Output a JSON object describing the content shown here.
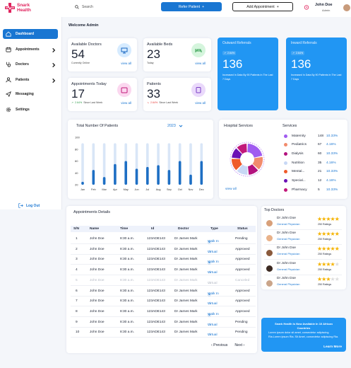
{
  "brand": {
    "name_line1": "Snark",
    "name_line2": "Health"
  },
  "topbar": {
    "search_placeholder": "Search",
    "refer_label": "Refer Patient",
    "appointment_label": "Add Appointment"
  },
  "user": {
    "name": "John Doe",
    "role": "Admin"
  },
  "sidebar": {
    "items": [
      {
        "label": "Dashboard"
      },
      {
        "label": "Appointments"
      },
      {
        "label": "Doctors"
      },
      {
        "label": "Patients"
      },
      {
        "label": "Messaging"
      },
      {
        "label": "Settings"
      }
    ],
    "logout": "Log Out"
  },
  "welcome": "Welcome Admin",
  "stats": [
    {
      "title": "Available Doctors",
      "value": "54",
      "sub": "Currently Online",
      "link": "view all"
    },
    {
      "title": "Available Beds",
      "value": "23",
      "sub": "Today",
      "link": "view all"
    },
    {
      "title": "Appointments Today",
      "value": "17",
      "sub": "Since Last Week",
      "delta": "2.64%",
      "link": "view all"
    },
    {
      "title": "Patients",
      "value": "33",
      "sub": "Since Last Week",
      "delta": "2.64%",
      "link": "view all"
    }
  ],
  "referrals": [
    {
      "title": "Outward Referrals",
      "badge": "2.64%",
      "value": "136",
      "sub": "Increased In Data  By 90 Patients In The Last 7 Days"
    },
    {
      "title": "Inward Referrals",
      "badge": "2.64%",
      "value": "136",
      "sub": "Increased In Data  By 90 Patients In The Last 7 Days"
    }
  ],
  "patients_chart": {
    "title": "Total Number Of Patients",
    "year": "2023"
  },
  "chart_data": {
    "type": "bar",
    "title": "Total Number Of Patients",
    "categories": [
      "Jan",
      "Feb",
      "Mar",
      "Apr",
      "May",
      "Jun",
      "Jul",
      "Aug",
      "Sep",
      "Oct",
      "Nov",
      "Dec"
    ],
    "series": [
      {
        "values": [
          25,
          45,
          33,
          55,
          60,
          47,
          50,
          53,
          45,
          60,
          37,
          60
        ]
      },
      {
        "values": [
          90,
          90,
          90,
          90,
          90,
          90,
          90,
          90,
          90,
          90,
          90,
          90
        ]
      }
    ],
    "yticks": [
      20,
      40,
      60,
      80,
      100
    ],
    "ylim": [
      20,
      100
    ],
    "colors": {
      "foreground": "#1e6fc4",
      "background": "#d9e6f7"
    }
  },
  "hospital_services": {
    "title": "Hospital Services",
    "services_label": "Services",
    "link": "view all",
    "items": [
      {
        "name": "Maternity",
        "count": "148",
        "pct": "10.33%",
        "color": "#a05bf0"
      },
      {
        "name": "Pediatrics",
        "count": "67",
        "pct": "4.16%",
        "color": "#f28b6c"
      },
      {
        "name": "Dialysis",
        "count": "60",
        "pct": "10.33%",
        "color": "#b3127e"
      },
      {
        "name": "Nutrition",
        "count": "35",
        "pct": "4.16%",
        "color": "#c8d8f5"
      },
      {
        "name": "Mental...",
        "count": "21",
        "pct": "10.33%",
        "color": "#ef5a29"
      },
      {
        "name": "Special...",
        "count": "12",
        "pct": "4.16%",
        "color": "#6a10b5"
      },
      {
        "name": "Pharmacy",
        "count": "5",
        "pct": "10.33%",
        "color": "#c2187a"
      }
    ]
  },
  "appointments": {
    "title": "Appointments Details",
    "headers": [
      "S/N",
      "Name",
      "Time",
      "Id",
      "Doctor",
      "Type",
      "Status"
    ],
    "rows": [
      {
        "sn": "1",
        "name": "John Doe",
        "time": "8:30 a.m.",
        "id": "123ADE143",
        "doctor": "Dr James Mark",
        "type": "Walk In",
        "status": "Pending",
        "dim": false
      },
      {
        "sn": "2",
        "name": "John Doe",
        "time": "8:30 a.m.",
        "id": "123ADE143",
        "doctor": "Dr James Mark",
        "type": "Virtual",
        "status": "Approved",
        "dim": false
      },
      {
        "sn": "3",
        "name": "John Doe",
        "time": "8:30 a.m.",
        "id": "123ADE143",
        "doctor": "Dr James Mark",
        "type": "Walk In",
        "status": "Approved",
        "dim": false
      },
      {
        "sn": "4",
        "name": "John Doe",
        "time": "8:30 a.m.",
        "id": "123ADE143",
        "doctor": "Dr James Mark",
        "type": "Virtual",
        "status": "Approved",
        "dim": false
      },
      {
        "sn": "5",
        "name": "John Doe",
        "time": "8:30 a.m.",
        "id": "123ADE143",
        "doctor": "Dr James Mark",
        "type": "Virtual",
        "status": "Canceled",
        "dim": true
      },
      {
        "sn": "6",
        "name": "John Doe",
        "time": "8:30 a.m.",
        "id": "123ADE143",
        "doctor": "Dr James Mark",
        "type": "Walk In",
        "status": "Approved",
        "dim": false
      },
      {
        "sn": "7",
        "name": "John Doe",
        "time": "8:30 a.m.",
        "id": "123ADE143",
        "doctor": "Dr James Mark",
        "type": "Virtual",
        "status": "Approved",
        "dim": false
      },
      {
        "sn": "8",
        "name": "John Doe",
        "time": "8:30 a.m.",
        "id": "123ADE143",
        "doctor": "Dr James Mark",
        "type": "Walk In",
        "status": "Approved",
        "dim": false
      },
      {
        "sn": "9",
        "name": "John Doe",
        "time": "8:30 a.m.",
        "id": "123ADE143",
        "doctor": "Dr James Mark",
        "type": "Virtual",
        "status": "Pending",
        "dim": false
      },
      {
        "sn": "10",
        "name": "John Doe",
        "time": "8:30 a.m.",
        "id": "123ADE143",
        "doctor": "Dr James Mark",
        "type": "Virtual",
        "status": "Pending",
        "dim": false
      }
    ],
    "prev": "Previous",
    "next": "Next"
  },
  "top_doctors": {
    "title": "Top Doctors",
    "items": [
      {
        "name": "Dr John Doe",
        "specialty": "General Physician",
        "ratings": "250 Ratings",
        "stars": 5
      },
      {
        "name": "Dr John Doe",
        "specialty": "General Physician",
        "ratings": "250 Ratings",
        "stars": 5
      },
      {
        "name": "Dr John Doe",
        "specialty": "General Physician",
        "ratings": "250 Ratings",
        "stars": 5
      },
      {
        "name": "Dr John Doe",
        "specialty": "General Physician",
        "ratings": "250 Ratings",
        "stars": 4
      },
      {
        "name": "Dr John Doe",
        "specialty": "General Physician",
        "ratings": "250 Ratings",
        "stars": 3
      }
    ]
  },
  "promo": {
    "title": "Snark Health Is Now Available In 10 African Countries",
    "body": "Lorem ipsum dolor sit amet, consectetur adipiscing Ria.Lorem ipsum Ria. Sit Amet, consectetur adipiscing Ria.",
    "link": "Learn More"
  }
}
